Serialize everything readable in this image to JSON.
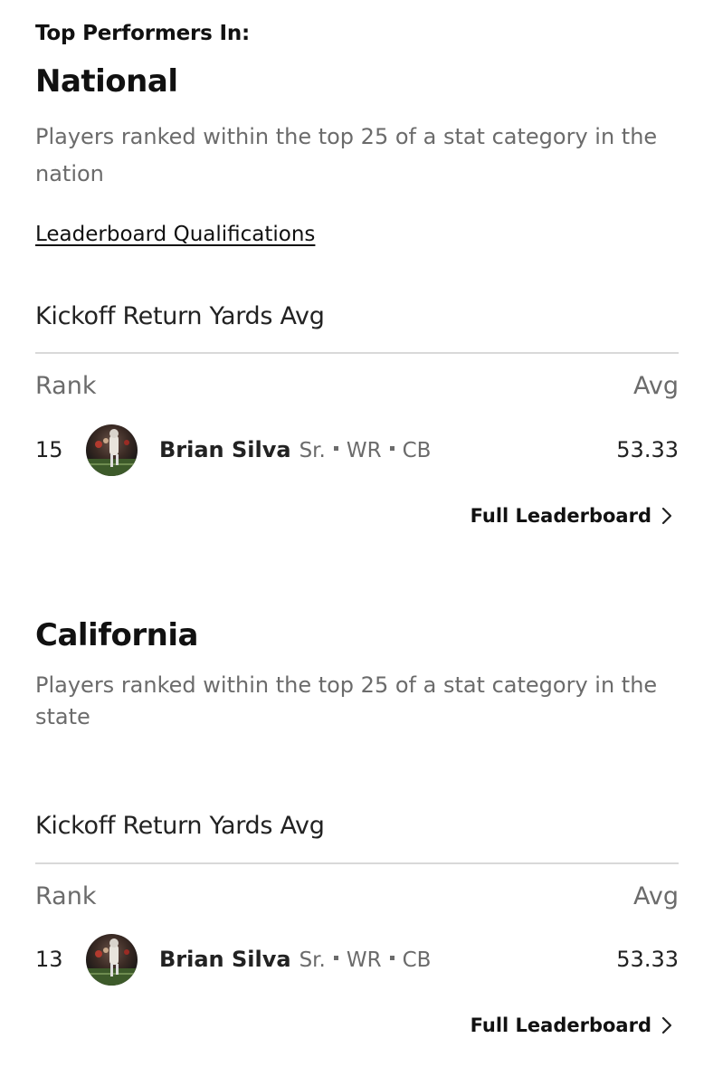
{
  "header": {
    "eyebrow": "Top Performers In:"
  },
  "links": {
    "qualifications": "Leaderboard Qualifications"
  },
  "sections": [
    {
      "title": "National",
      "description": "Players ranked within the top 25 of a stat category in the nation",
      "category": "Kickoff Return Yards Avg",
      "rank_header": "Rank",
      "avg_header": "Avg",
      "row": {
        "rank": "15",
        "name": "Brian Silva",
        "class": "Sr.",
        "pos1": "WR",
        "pos2": "CB",
        "avg": "53.33"
      },
      "full_leaderboard": "Full Leaderboard"
    },
    {
      "title": "California",
      "description": "Players ranked within the top 25 of a stat category in the state",
      "category": "Kickoff Return Yards Avg",
      "rank_header": "Rank",
      "avg_header": "Avg",
      "row": {
        "rank": "13",
        "name": "Brian Silva",
        "class": "Sr.",
        "pos1": "WR",
        "pos2": "CB",
        "avg": "53.33"
      },
      "full_leaderboard": "Full Leaderboard"
    }
  ],
  "icons": {
    "avatar": "player-photo",
    "chevron": "chevron-right-icon"
  }
}
